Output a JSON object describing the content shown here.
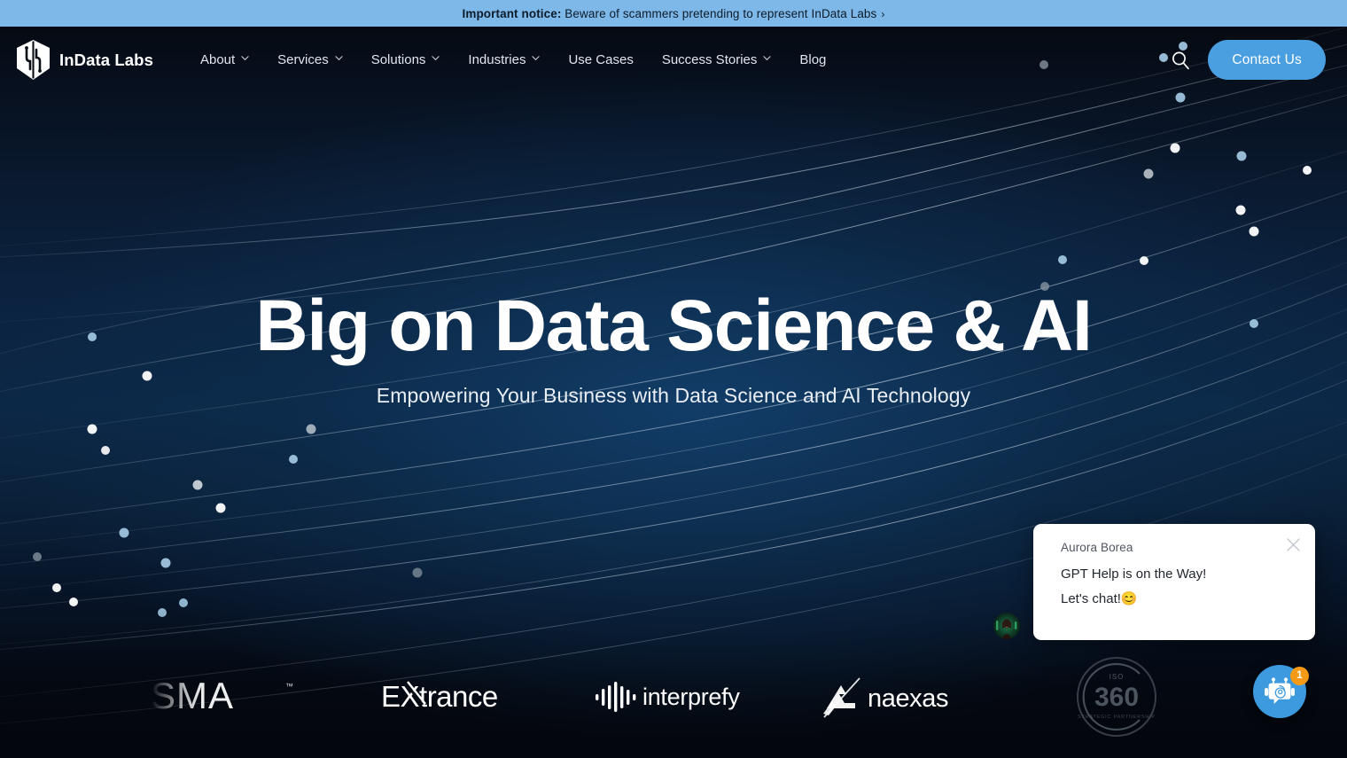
{
  "notice": {
    "lead": "Important notice:",
    "text": " Beware of scammers pretending to represent InData Labs",
    "arrow": "›",
    "bg_color": "#7db8e8"
  },
  "header": {
    "logo_text": "InData Labs",
    "logo_icon": "indata-labs-shield-logo",
    "search_icon": "search-icon",
    "contact_label": "Contact Us",
    "accent_color": "#4a9fe0",
    "nav": [
      {
        "label": "About",
        "has_dropdown": true
      },
      {
        "label": "Services",
        "has_dropdown": true
      },
      {
        "label": "Solutions",
        "has_dropdown": true
      },
      {
        "label": "Industries",
        "has_dropdown": true
      },
      {
        "label": "Use Cases",
        "has_dropdown": false
      },
      {
        "label": "Success Stories",
        "has_dropdown": true
      },
      {
        "label": "Blog",
        "has_dropdown": false
      }
    ]
  },
  "hero": {
    "title": "Big on Data Science & AI",
    "subtitle": "Empowering Your Business with Data Science and AI Technology"
  },
  "clients": [
    {
      "name": "SMA",
      "icon": "sma-logo"
    },
    {
      "name": "EXtrance",
      "icon": "extrance-logo"
    },
    {
      "name": "interprefy",
      "icon": "interprefy-logo"
    },
    {
      "name": "naexas",
      "icon": "naexas-logo"
    },
    {
      "name": "360",
      "icon": "iso-360-logo"
    }
  ],
  "chat": {
    "agent_name": "Aurora Borea",
    "message_line1": "GPT Help is on the Way!",
    "message_line2": "Let's chat!😊",
    "close_icon": "close-icon",
    "fab_icon": "chat-bot-icon",
    "badge_count": "1",
    "badge_color": "#f59a16",
    "fab_color": "#3e9ade"
  }
}
